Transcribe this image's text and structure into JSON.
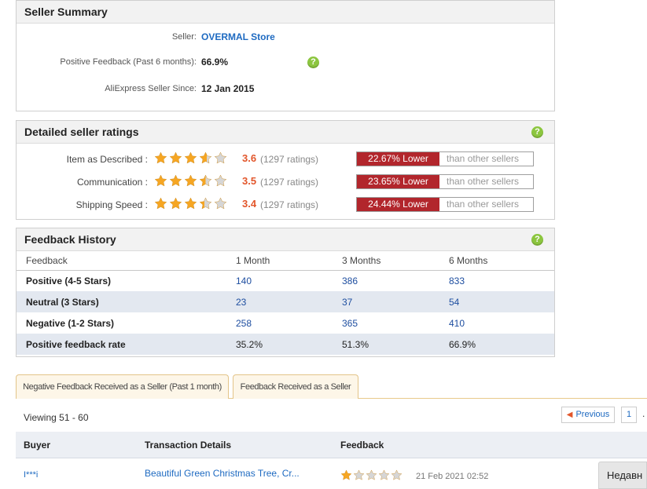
{
  "seller_summary": {
    "title": "Seller Summary",
    "seller_label": "Seller:",
    "seller_name": "OVERMAL Store",
    "positive_label": "Positive Feedback (Past 6 months):",
    "positive_value": "66.9%",
    "since_label": "AliExpress Seller Since:",
    "since_value": "12 Jan 2015"
  },
  "detailed_ratings": {
    "title": "Detailed seller ratings",
    "items": [
      {
        "label": "Item as Described :",
        "score": "3.6",
        "stars": 3.6,
        "count": "(1297 ratings)",
        "compare": "22.67% Lower",
        "compare_suffix": "than other sellers"
      },
      {
        "label": "Communication :",
        "score": "3.5",
        "stars": 3.5,
        "count": "(1297 ratings)",
        "compare": "23.65% Lower",
        "compare_suffix": "than other sellers"
      },
      {
        "label": "Shipping Speed :",
        "score": "3.4",
        "stars": 3.4,
        "count": "(1297 ratings)",
        "compare": "24.44% Lower",
        "compare_suffix": "than other sellers"
      }
    ]
  },
  "feedback_history": {
    "title": "Feedback History",
    "headers": [
      "Feedback",
      "1 Month",
      "3 Months",
      "6 Months"
    ],
    "rows": [
      {
        "label": "Positive (4-5 Stars)",
        "values": [
          "140",
          "386",
          "833"
        ]
      },
      {
        "label": "Neutral (3 Stars)",
        "values": [
          "23",
          "37",
          "54"
        ]
      },
      {
        "label": "Negative (1-2 Stars)",
        "values": [
          "258",
          "365",
          "410"
        ]
      },
      {
        "label": "Positive feedback rate",
        "values": [
          "35.2%",
          "51.3%",
          "66.9%"
        ]
      }
    ]
  },
  "tabs": [
    {
      "label": "Negative Feedback Received as a Seller (Past 1 month)"
    },
    {
      "label": "Feedback Received as a Seller"
    }
  ],
  "pagination": {
    "viewing": "Viewing 51 - 60",
    "prev_label": "Previous",
    "page": "1",
    "more": "."
  },
  "list": {
    "headers": {
      "buyer": "Buyer",
      "transaction": "Transaction Details",
      "feedback": "Feedback"
    },
    "rows": [
      {
        "buyer": "I***i",
        "transaction": "Beautiful Green Christmas Tree, Cr...",
        "stars": 1,
        "date": "21 Feb 2021 02:52"
      }
    ]
  },
  "side_button": {
    "label": "Недавн"
  },
  "colors": {
    "star_fill": "#f6a623",
    "star_empty": "#d6d6d6",
    "lower_badge": "#b2262c",
    "score": "#e2562b",
    "link": "#1e6ac1",
    "help_icon": "#8cc63f"
  }
}
